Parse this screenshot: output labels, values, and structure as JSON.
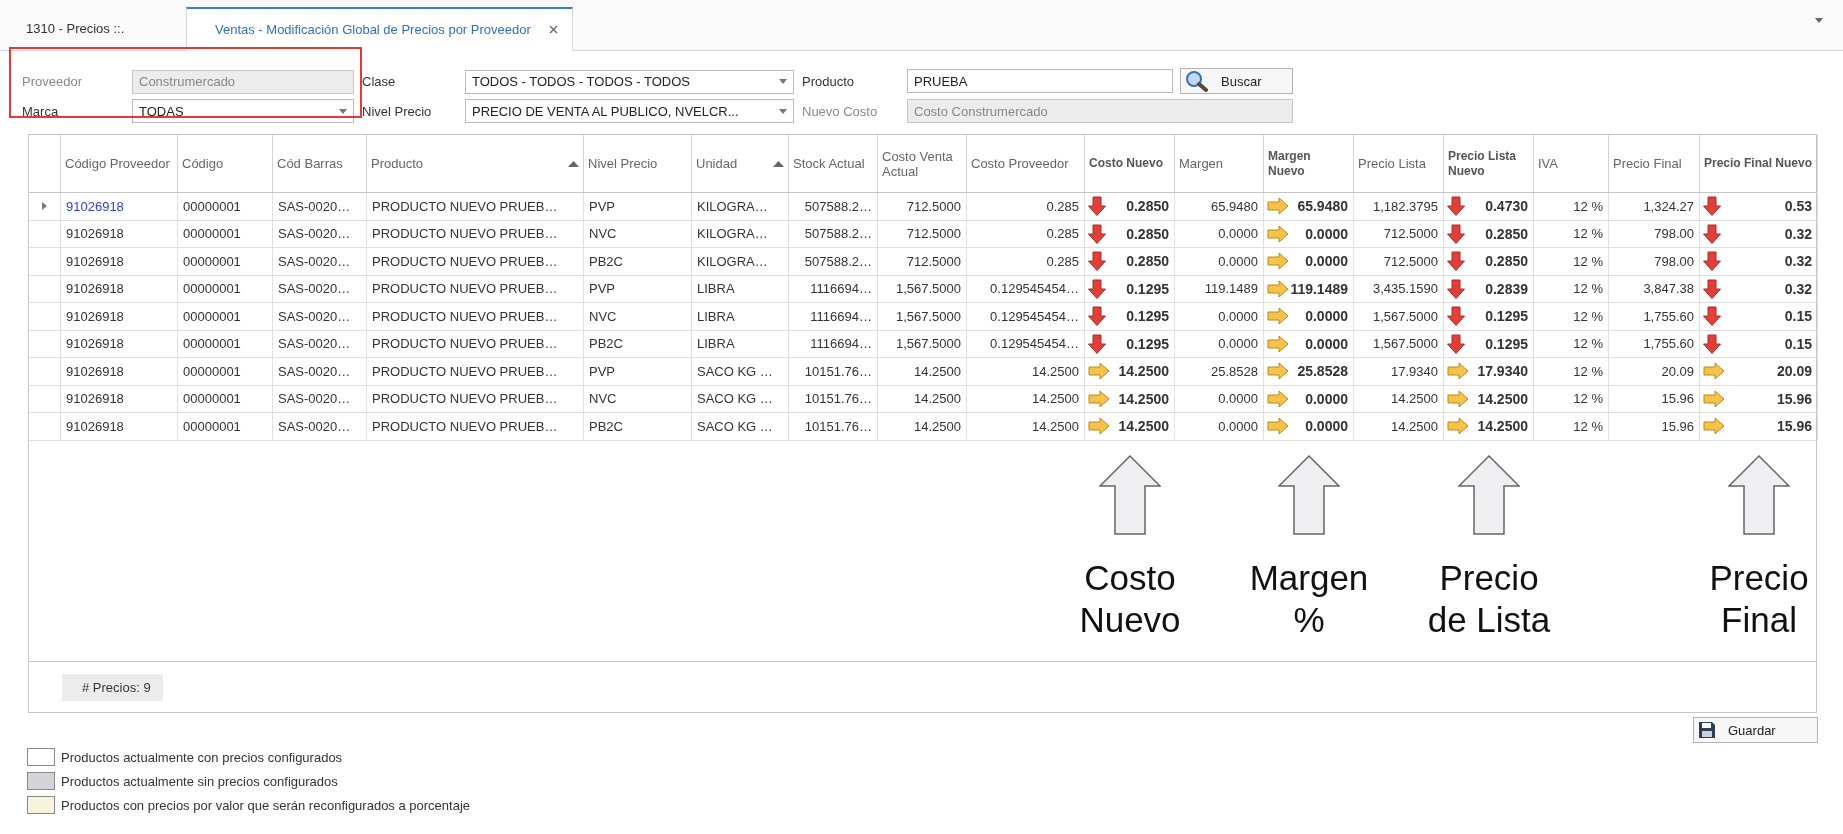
{
  "tabs": [
    {
      "label": "1310 - Precios ::.",
      "selected": false,
      "closable": false
    },
    {
      "label": "Ventas - Modificación Global de Precios por Proveedor",
      "selected": true,
      "closable": true
    }
  ],
  "form": {
    "rows": [
      {
        "fields": [
          {
            "label": "Proveedor",
            "value": "Construmercado",
            "kind": "text",
            "disabled": true
          },
          {
            "label": "Clase",
            "value": "TODOS - TODOS - TODOS - TODOS",
            "kind": "combo",
            "disabled": false
          },
          {
            "label": "Producto",
            "value": "PRUEBA",
            "kind": "text",
            "disabled": false
          }
        ],
        "button": {
          "label": "Buscar"
        }
      },
      {
        "fields": [
          {
            "label": "Marca",
            "value": "TODAS",
            "kind": "combo",
            "disabled": false
          },
          {
            "label": "Nivel Precio",
            "value": "PRECIO DE VENTA AL PUBLICO, NVELCR...",
            "kind": "combo",
            "disabled": false
          },
          {
            "label": "Nuevo Costo",
            "value": "Costo Construmercado",
            "kind": "text",
            "disabled": true
          }
        ]
      }
    ]
  },
  "table": {
    "columns": [
      {
        "label": "Código Proveedor",
        "kind": "text",
        "sorted_ascending": false
      },
      {
        "label": "Código",
        "kind": "text",
        "sorted_ascending": false
      },
      {
        "label": "Cód Barras",
        "kind": "text",
        "sorted_ascending": false
      },
      {
        "label": "Producto",
        "kind": "text",
        "sorted_ascending": true
      },
      {
        "label": "Nivel Precio",
        "kind": "text",
        "sorted_ascending": false
      },
      {
        "label": "Unidad",
        "kind": "text",
        "sorted_ascending": true
      },
      {
        "label": "Stock Actual",
        "kind": "number",
        "sorted_ascending": false
      },
      {
        "label": "Costo Venta Actual",
        "kind": "number",
        "sorted_ascending": false
      },
      {
        "label": "Costo Proveedor",
        "kind": "number",
        "sorted_ascending": false
      },
      {
        "label": "Costo Nuevo",
        "kind": "trend",
        "sorted_ascending": false
      },
      {
        "label": "Margen",
        "kind": "number",
        "sorted_ascending": false
      },
      {
        "label": "Margen Nuevo",
        "kind": "trend",
        "sorted_ascending": false
      },
      {
        "label": "Precio Lista",
        "kind": "number",
        "sorted_ascending": false
      },
      {
        "label": "Precio Lista Nuevo",
        "kind": "trend",
        "sorted_ascending": false
      },
      {
        "label": "IVA",
        "kind": "number",
        "sorted_ascending": false
      },
      {
        "label": "Precio Final",
        "kind": "number",
        "sorted_ascending": false
      },
      {
        "label": "Precio Final Nuevo",
        "kind": "trend",
        "sorted_ascending": false
      }
    ],
    "rows": [
      {
        "selected": true,
        "cells": [
          "91026918",
          "00000001",
          "SAS-0020…",
          "PRODUCTO NUEVO PRUEB…",
          "PVP",
          "KILOGRA…",
          "507588.2…",
          "712.5000",
          "0.285",
          {
            "value": "0.2850",
            "kind": "down"
          },
          "65.9480",
          {
            "value": "65.9480",
            "kind": "right"
          },
          "1,182.3795",
          {
            "value": "0.4730",
            "kind": "down"
          },
          "12 %",
          "1,324.27",
          {
            "value": "0.53",
            "kind": "down"
          }
        ]
      },
      {
        "selected": false,
        "cells": [
          "91026918",
          "00000001",
          "SAS-0020…",
          "PRODUCTO NUEVO PRUEB…",
          "NVC",
          "KILOGRA…",
          "507588.2…",
          "712.5000",
          "0.285",
          {
            "value": "0.2850",
            "kind": "down"
          },
          "0.0000",
          {
            "value": "0.0000",
            "kind": "right"
          },
          "712.5000",
          {
            "value": "0.2850",
            "kind": "down"
          },
          "12 %",
          "798.00",
          {
            "value": "0.32",
            "kind": "down"
          }
        ]
      },
      {
        "selected": false,
        "cells": [
          "91026918",
          "00000001",
          "SAS-0020…",
          "PRODUCTO NUEVO PRUEB…",
          "PB2C",
          "KILOGRA…",
          "507588.2…",
          "712.5000",
          "0.285",
          {
            "value": "0.2850",
            "kind": "down"
          },
          "0.0000",
          {
            "value": "0.0000",
            "kind": "right"
          },
          "712.5000",
          {
            "value": "0.2850",
            "kind": "down"
          },
          "12 %",
          "798.00",
          {
            "value": "0.32",
            "kind": "down"
          }
        ]
      },
      {
        "selected": false,
        "cells": [
          "91026918",
          "00000001",
          "SAS-0020…",
          "PRODUCTO NUEVO PRUEB…",
          "PVP",
          "LIBRA",
          "1116694…",
          "1,567.5000",
          "0.129545454…",
          {
            "value": "0.1295",
            "kind": "down"
          },
          "119.1489",
          {
            "value": "119.1489",
            "kind": "right"
          },
          "3,435.1590",
          {
            "value": "0.2839",
            "kind": "down"
          },
          "12 %",
          "3,847.38",
          {
            "value": "0.32",
            "kind": "down"
          }
        ]
      },
      {
        "selected": false,
        "cells": [
          "91026918",
          "00000001",
          "SAS-0020…",
          "PRODUCTO NUEVO PRUEB…",
          "NVC",
          "LIBRA",
          "1116694…",
          "1,567.5000",
          "0.129545454…",
          {
            "value": "0.1295",
            "kind": "down"
          },
          "0.0000",
          {
            "value": "0.0000",
            "kind": "right"
          },
          "1,567.5000",
          {
            "value": "0.1295",
            "kind": "down"
          },
          "12 %",
          "1,755.60",
          {
            "value": "0.15",
            "kind": "down"
          }
        ]
      },
      {
        "selected": false,
        "cells": [
          "91026918",
          "00000001",
          "SAS-0020…",
          "PRODUCTO NUEVO PRUEB…",
          "PB2C",
          "LIBRA",
          "1116694…",
          "1,567.5000",
          "0.129545454…",
          {
            "value": "0.1295",
            "kind": "down"
          },
          "0.0000",
          {
            "value": "0.0000",
            "kind": "right"
          },
          "1,567.5000",
          {
            "value": "0.1295",
            "kind": "down"
          },
          "12 %",
          "1,755.60",
          {
            "value": "0.15",
            "kind": "down"
          }
        ]
      },
      {
        "selected": false,
        "cells": [
          "91026918",
          "00000001",
          "SAS-0020…",
          "PRODUCTO NUEVO PRUEB…",
          "PVP",
          "SACO KG …",
          "10151.76…",
          "14.2500",
          "14.2500",
          {
            "value": "14.2500",
            "kind": "right"
          },
          "25.8528",
          {
            "value": "25.8528",
            "kind": "right"
          },
          "17.9340",
          {
            "value": "17.9340",
            "kind": "right"
          },
          "12 %",
          "20.09",
          {
            "value": "20.09",
            "kind": "right"
          }
        ]
      },
      {
        "selected": false,
        "cells": [
          "91026918",
          "00000001",
          "SAS-0020…",
          "PRODUCTO NUEVO PRUEB…",
          "NVC",
          "SACO KG …",
          "10151.76…",
          "14.2500",
          "14.2500",
          {
            "value": "14.2500",
            "kind": "right"
          },
          "0.0000",
          {
            "value": "0.0000",
            "kind": "right"
          },
          "14.2500",
          {
            "value": "14.2500",
            "kind": "right"
          },
          "12 %",
          "15.96",
          {
            "value": "15.96",
            "kind": "right"
          }
        ]
      },
      {
        "selected": false,
        "cells": [
          "91026918",
          "00000001",
          "SAS-0020…",
          "PRODUCTO NUEVO PRUEB…",
          "PB2C",
          "SACO KG …",
          "10151.76…",
          "14.2500",
          "14.2500",
          {
            "value": "14.2500",
            "kind": "right"
          },
          "0.0000",
          {
            "value": "0.0000",
            "kind": "right"
          },
          "14.2500",
          {
            "value": "14.2500",
            "kind": "right"
          },
          "12 %",
          "15.96",
          {
            "value": "15.96",
            "kind": "right"
          }
        ]
      }
    ],
    "footer": "# Precios: 9"
  },
  "callouts": [
    {
      "label": "Costo Nuevo"
    },
    {
      "label": "Margen %"
    },
    {
      "label": "Precio de Lista"
    },
    {
      "label": "Precio Final"
    }
  ],
  "save_button": {
    "label": "Guardar"
  },
  "legend": [
    {
      "label": "Productos actualmente con precios configurados",
      "color": "#ffffff"
    },
    {
      "label": "Productos actualmente sin precios configurados",
      "color": "#d4d4d8"
    },
    {
      "label": "Productos con precios por valor que serán reconfigurados a porcentaje",
      "color": "#f7f3dc"
    }
  ]
}
